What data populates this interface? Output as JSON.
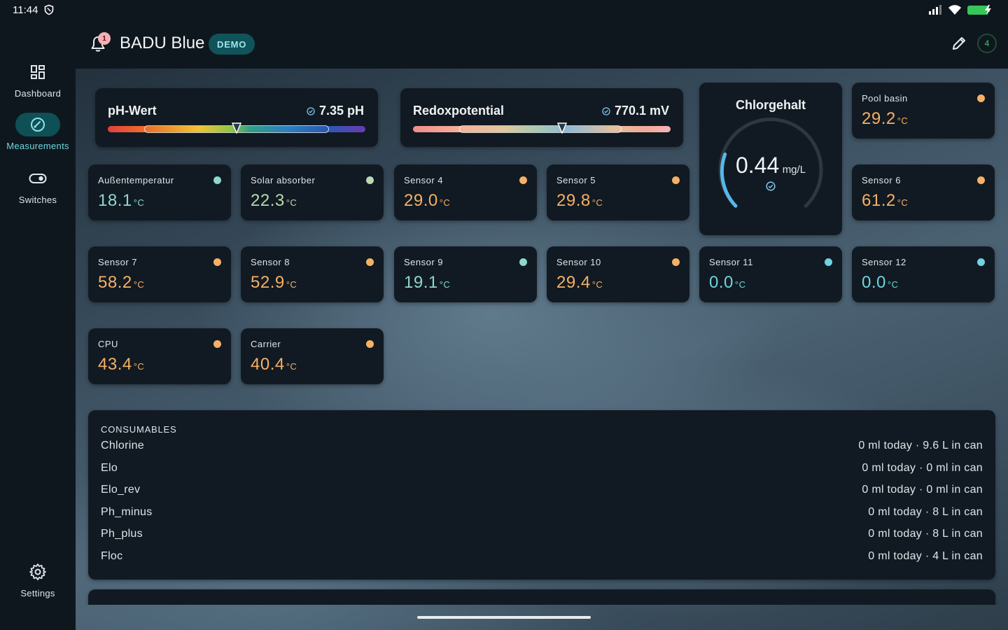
{
  "status": {
    "time": "11:44"
  },
  "nav": {
    "items": [
      {
        "label": "Dashboard",
        "icon": "dashboard-icon"
      },
      {
        "label": "Measurements",
        "icon": "gauge-icon"
      },
      {
        "label": "Switches",
        "icon": "toggle-icon"
      }
    ],
    "settings": {
      "label": "Settings",
      "icon": "gear-icon"
    }
  },
  "header": {
    "title": "BADU Blue",
    "badge": "DEMO",
    "notifications": "1",
    "counter": "4"
  },
  "ph": {
    "label": "pH-Wert",
    "value": "7.35 pH",
    "marker": 0.5
  },
  "redox": {
    "label": "Redoxpotential",
    "value": "770.1 mV",
    "marker": 0.58
  },
  "chlorine": {
    "title": "Chlorgehalt",
    "value": "0.44",
    "unit": "mg/L",
    "level": 0.2
  },
  "sensors": [
    {
      "name": "Pool basin",
      "value": "29.2",
      "unit": "°C",
      "status": "orange"
    },
    {
      "name": "Außentemperatur",
      "value": "18.1",
      "unit": "°C",
      "status": "teal"
    },
    {
      "name": "Solar absorber",
      "value": "22.3",
      "unit": "°C",
      "status": "green"
    },
    {
      "name": "Sensor 4",
      "value": "29.0",
      "unit": "°C",
      "status": "orange"
    },
    {
      "name": "Sensor 5",
      "value": "29.8",
      "unit": "°C",
      "status": "orange"
    },
    {
      "name": "Sensor 6",
      "value": "61.2",
      "unit": "°C",
      "status": "orange"
    },
    {
      "name": "Sensor 7",
      "value": "58.2",
      "unit": "°C",
      "status": "orange"
    },
    {
      "name": "Sensor 8",
      "value": "52.9",
      "unit": "°C",
      "status": "orange"
    },
    {
      "name": "Sensor 9",
      "value": "19.1",
      "unit": "°C",
      "status": "teal"
    },
    {
      "name": "Sensor 10",
      "value": "29.4",
      "unit": "°C",
      "status": "orange"
    },
    {
      "name": "Sensor 11",
      "value": "0.0",
      "unit": "°C",
      "status": "cyan"
    },
    {
      "name": "Sensor 12",
      "value": "0.0",
      "unit": "°C",
      "status": "cyan"
    },
    {
      "name": "CPU",
      "value": "43.4",
      "unit": "°C",
      "status": "orange"
    },
    {
      "name": "Carrier",
      "value": "40.4",
      "unit": "°C",
      "status": "orange"
    }
  ],
  "colors": {
    "orange": "#f6b066",
    "teal": "#8fd6d0",
    "green": "#b9d9b0",
    "cyan": "#6fd3e0"
  },
  "consumables": {
    "heading": "CONSUMABLES",
    "rows": [
      {
        "name": "Chlorine",
        "detail": "0 ml today · 9.6 L in can"
      },
      {
        "name": "Elo",
        "detail": "0 ml today · 0 ml in can"
      },
      {
        "name": "Elo_rev",
        "detail": "0 ml today · 0 ml in can"
      },
      {
        "name": "Ph_minus",
        "detail": "0 ml today · 8 L in can"
      },
      {
        "name": "Ph_plus",
        "detail": "0 ml today · 8 L in can"
      },
      {
        "name": "Floc",
        "detail": "0 ml today · 4 L in can"
      }
    ]
  }
}
